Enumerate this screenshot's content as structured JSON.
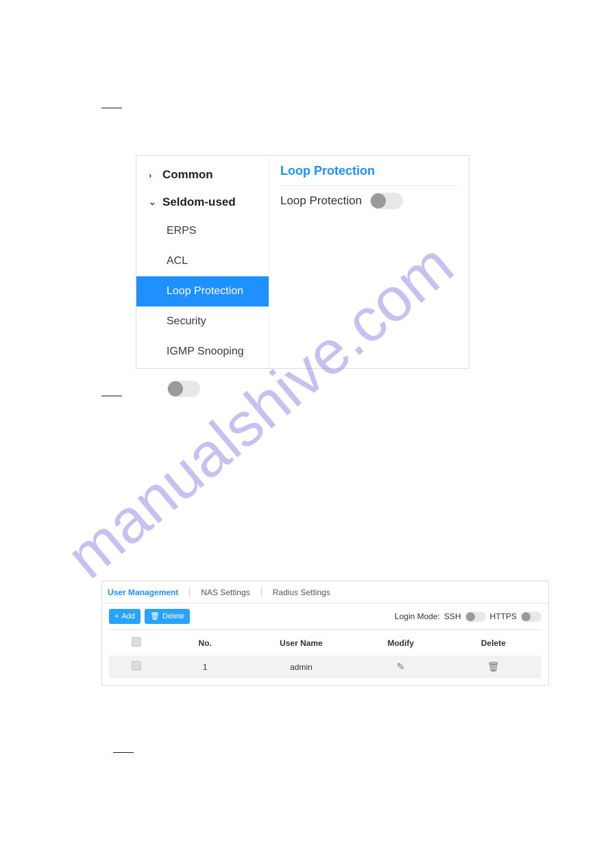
{
  "watermark": "manualshive.com",
  "sidebar": {
    "group_common": "Common",
    "caret_common": "›",
    "group_seldom": "Seldom-used",
    "caret_seldom": "⌄",
    "items": [
      {
        "label": "ERPS"
      },
      {
        "label": "ACL"
      },
      {
        "label": "Loop Protection"
      },
      {
        "label": "Security"
      },
      {
        "label": "IGMP Snooping"
      }
    ]
  },
  "content1": {
    "title": "Loop Protection",
    "row_label": "Loop Protection"
  },
  "tabs": [
    {
      "label": "User Management"
    },
    {
      "label": "NAS Settings"
    },
    {
      "label": "Radius Settings"
    }
  ],
  "toolbar": {
    "add": "Add",
    "delete": "Delete",
    "login_mode_label": "Login Mode:",
    "ssh_label": "SSH",
    "https_label": "HTTPS"
  },
  "table": {
    "headers": {
      "no": "No.",
      "username": "User Name",
      "modify": "Modify",
      "delete": "Delete"
    },
    "row1": {
      "no": "1",
      "username": "admin"
    }
  }
}
